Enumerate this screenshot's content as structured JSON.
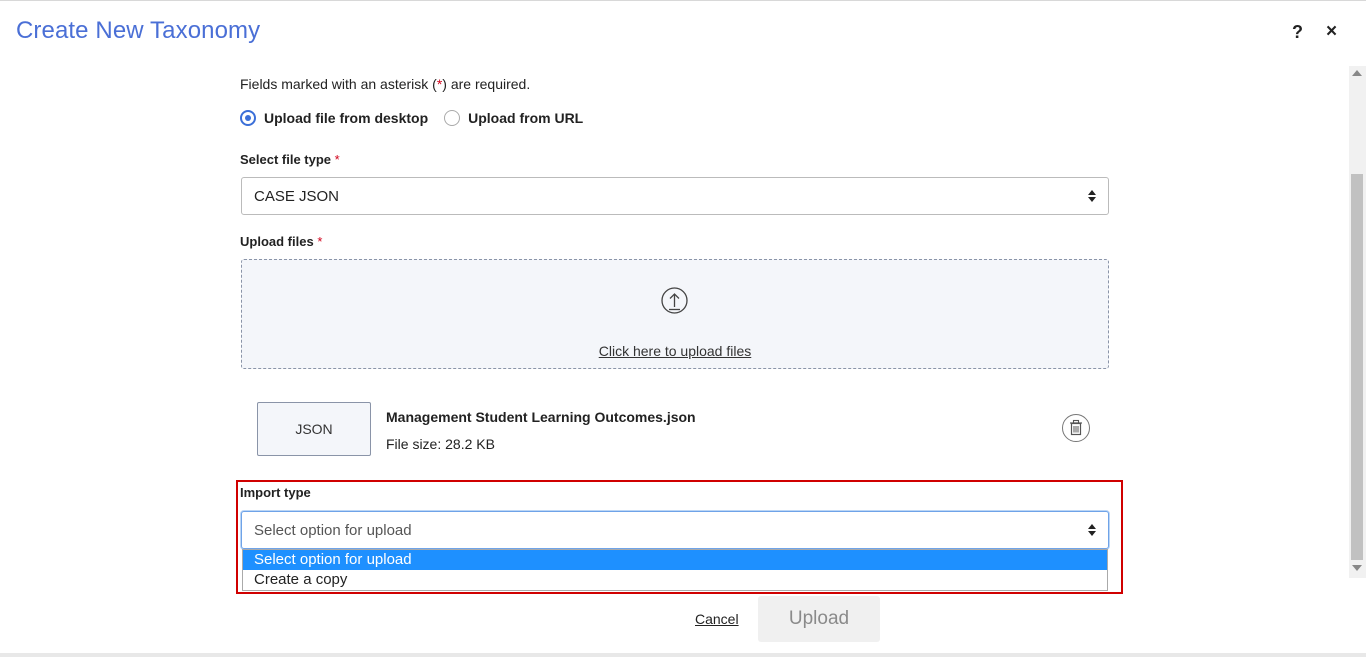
{
  "header": {
    "title": "Create New Taxonomy",
    "help_label": "?",
    "close_label": "×"
  },
  "form": {
    "hint_prefix": "Fields marked with an asterisk (",
    "hint_asterisk": "*",
    "hint_suffix": ") are required.",
    "source_options": [
      {
        "label": "Upload file from desktop",
        "selected": true
      },
      {
        "label": "Upload from URL",
        "selected": false
      }
    ],
    "file_type": {
      "label": "Select file type",
      "required_mark": "*",
      "value": "CASE JSON"
    },
    "upload": {
      "label": "Upload files",
      "required_mark": "*",
      "link_text": "Click here to upload files"
    },
    "file": {
      "type_badge": "JSON",
      "name": "Management Student Learning Outcomes.json",
      "size": "File size: 28.2 KB"
    },
    "import_type": {
      "label": "Import type",
      "value": "Select option for upload",
      "options": [
        {
          "label": "Select option for upload",
          "selected": true
        },
        {
          "label": "Create a copy",
          "selected": false
        }
      ]
    }
  },
  "footer": {
    "cancel_label": "Cancel",
    "upload_label": "Upload"
  },
  "colors": {
    "title": "#4a6fd6",
    "required": "#d0021b",
    "highlight": "#d00000",
    "option_selected": "#1e90ff"
  }
}
